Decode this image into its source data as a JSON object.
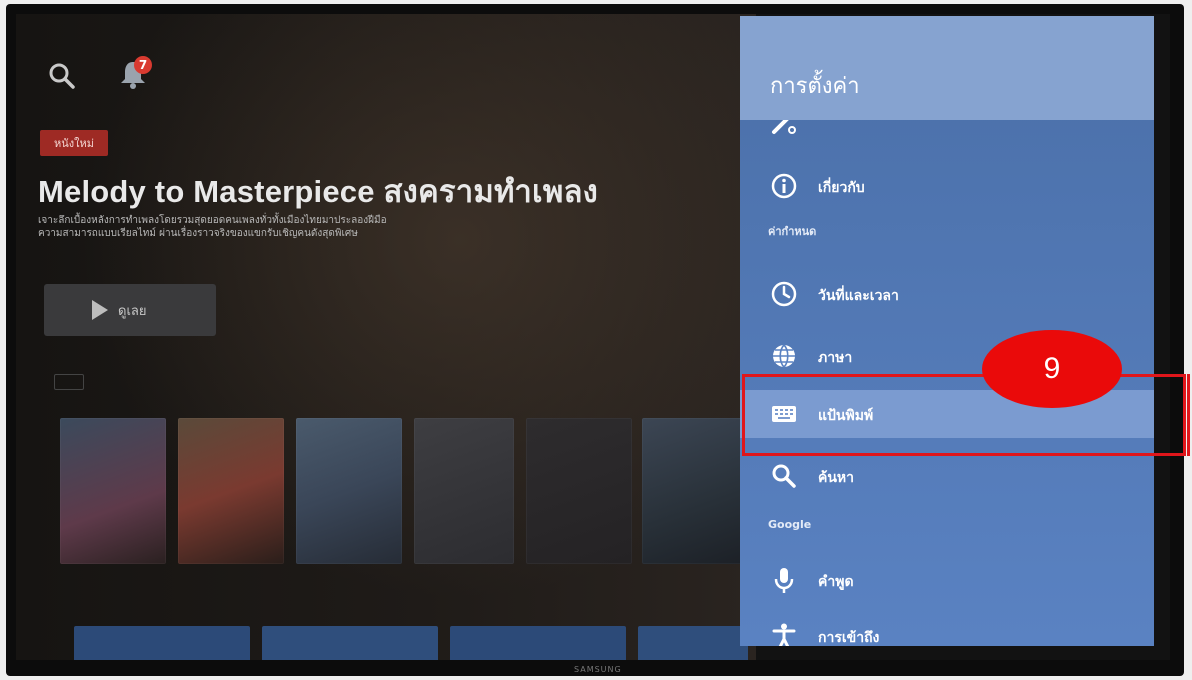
{
  "hero": {
    "new_badge": "หนังใหม่",
    "title": "Melody to Masterpiece สงครามทำเพลง",
    "description_line1": "เจาะลึกเบื้องหลังการทำเพลงโดยรวมสุดยอดคนเพลงทั่วทั้งเมืองไทยมาประลองฝีมือ",
    "description_line2": "ความสามารถแบบเรียลไทม์ ผ่านเรื่องราวจริงของแขกรับเชิญคนดังสุดพิเศษ",
    "watch_label": "ดูเลย"
  },
  "notifications": {
    "count": "7"
  },
  "settings": {
    "title": "การตั้งค่า",
    "items": [
      {
        "label": "เกี่ยวกับ",
        "icon": "info-icon"
      },
      {
        "label": "วันที่และเวลา",
        "icon": "clock-icon"
      },
      {
        "label": "ภาษา",
        "icon": "globe-icon"
      },
      {
        "label": "แป้นพิมพ์",
        "icon": "keyboard-icon"
      },
      {
        "label": "ค้นหา",
        "icon": "search-icon"
      },
      {
        "label": "คำพูด",
        "icon": "microphone-icon"
      },
      {
        "label": "การเข้าถึง",
        "icon": "accessibility-icon"
      }
    ],
    "sections": {
      "preferences": "ค่ากำหนด",
      "google": "Google"
    }
  },
  "callout": {
    "number": "9"
  },
  "tv": {
    "brand": "SAMSUNG"
  },
  "colors": {
    "panel": "#5a82c2",
    "panel_header": "#86a3d0",
    "highlight": "#7b9bd0",
    "callout": "#e0161b"
  }
}
